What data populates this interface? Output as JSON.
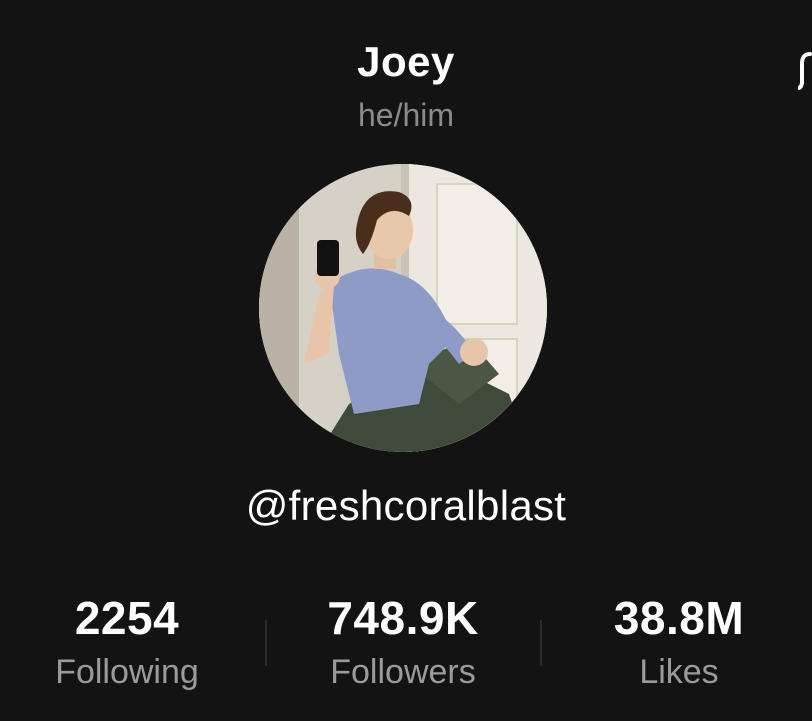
{
  "profile": {
    "display_name": "Joey",
    "pronouns": "he/him",
    "username": "@freshcoralblast",
    "avatar_icon": "profile-photo"
  },
  "stats": {
    "following": {
      "value": "2254",
      "label": "Following"
    },
    "followers": {
      "value": "748.9K",
      "label": "Followers"
    },
    "likes": {
      "value": "38.8M",
      "label": "Likes"
    }
  },
  "icons": {
    "edge_icon": "partial-icon"
  },
  "colors": {
    "background": "#131313",
    "primary_text": "#ffffff",
    "secondary_text": "#8b8b8b"
  }
}
